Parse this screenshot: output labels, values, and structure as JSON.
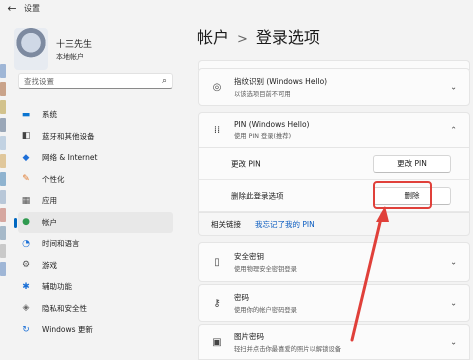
{
  "titlebar": {
    "back_glyph": "←",
    "title": "设置"
  },
  "profile": {
    "name": "十三先生",
    "subtitle": "本地帐户"
  },
  "search": {
    "placeholder": "查找设置",
    "icon": "search-icon"
  },
  "nav": {
    "items": [
      {
        "label": "系统",
        "icon": "monitor-icon",
        "color": "#0a74d1",
        "active": false
      },
      {
        "label": "蓝牙和其他设备",
        "icon": "bluetooth-devices-icon",
        "color": "#444444",
        "active": false
      },
      {
        "label": "网络 & Internet",
        "icon": "wifi-icon",
        "color": "#1e6fd8",
        "active": false
      },
      {
        "label": "个性化",
        "icon": "paintbrush-icon",
        "color": "#e07a2e",
        "active": false
      },
      {
        "label": "应用",
        "icon": "apps-icon",
        "color": "#555555",
        "active": false
      },
      {
        "label": "帐户",
        "icon": "account-icon",
        "color": "#2f9a4f",
        "active": true
      },
      {
        "label": "时间和语言",
        "icon": "globe-clock-icon",
        "color": "#1a6fd6",
        "active": false
      },
      {
        "label": "游戏",
        "icon": "gamepad-icon",
        "color": "#555555",
        "active": false
      },
      {
        "label": "辅助功能",
        "icon": "accessibility-icon",
        "color": "#1a6fd6",
        "active": false
      },
      {
        "label": "隐私和安全性",
        "icon": "shield-icon",
        "color": "#666666",
        "active": false
      },
      {
        "label": "Windows 更新",
        "icon": "windows-update-icon",
        "color": "#1a6fd6",
        "active": false
      }
    ]
  },
  "breadcrumb": {
    "parent": "帐户",
    "separator": ">",
    "current": "登录选项"
  },
  "fingerprint": {
    "title": "指纹识别 (Windows Hello)",
    "subtitle": "以该选项目前不可用",
    "icon": "fingerprint-icon"
  },
  "pin": {
    "title": "PIN (Windows Hello)",
    "subtitle": "使用 PIN 登录(推荐)",
    "icon": "pin-keypad-icon",
    "change_label": "更改 PIN",
    "change_button": "更改 PIN",
    "remove_label": "删除此登录选项",
    "remove_button": "删除"
  },
  "related": {
    "label": "相关链接",
    "link": "我忘记了我的 PIN"
  },
  "security_key": {
    "title": "安全密钥",
    "subtitle": "使用物理安全密钥登录",
    "icon": "usb-key-icon"
  },
  "password": {
    "title": "密码",
    "subtitle": "使用你的帐户密码登录",
    "icon": "key-icon"
  },
  "picture_password": {
    "title": "图片密码",
    "subtitle": "轻扫并点击你最喜爱的照片以解锁设备",
    "icon": "picture-icon"
  },
  "annotation": {
    "color": "#e0403a"
  }
}
